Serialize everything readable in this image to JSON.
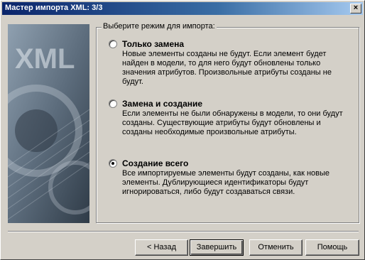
{
  "window": {
    "title": "Мастер импорта XML: 3/3",
    "close_label": "×"
  },
  "side_image": {
    "caption": "XML"
  },
  "mode_group": {
    "label": "Выберите режим для импорта:",
    "options": [
      {
        "title": "Только замена",
        "description": "Новые элементы созданы не будут. Если элемент будет найден в модели, то для него будут обновлены только значения атрибутов. Произвольные атрибуты созданы не будут.",
        "checked": false
      },
      {
        "title": "Замена и создание",
        "description": "Если элементы не были обнаружены в модели, то они будут созданы. Существующие атрибуты будут обновлены и созданы необходимые произвольные атрибуты.",
        "checked": false
      },
      {
        "title": "Создание всего",
        "description": "Все импортируемые элементы будут созданы, как новые элементы. Дублирующиеся идентификаторы будут игнорироваться, либо будут создаваться связи.",
        "checked": true
      }
    ]
  },
  "buttons": {
    "back": "< Назад",
    "finish": "Завершить",
    "cancel": "Отменить",
    "help": "Помощь"
  }
}
